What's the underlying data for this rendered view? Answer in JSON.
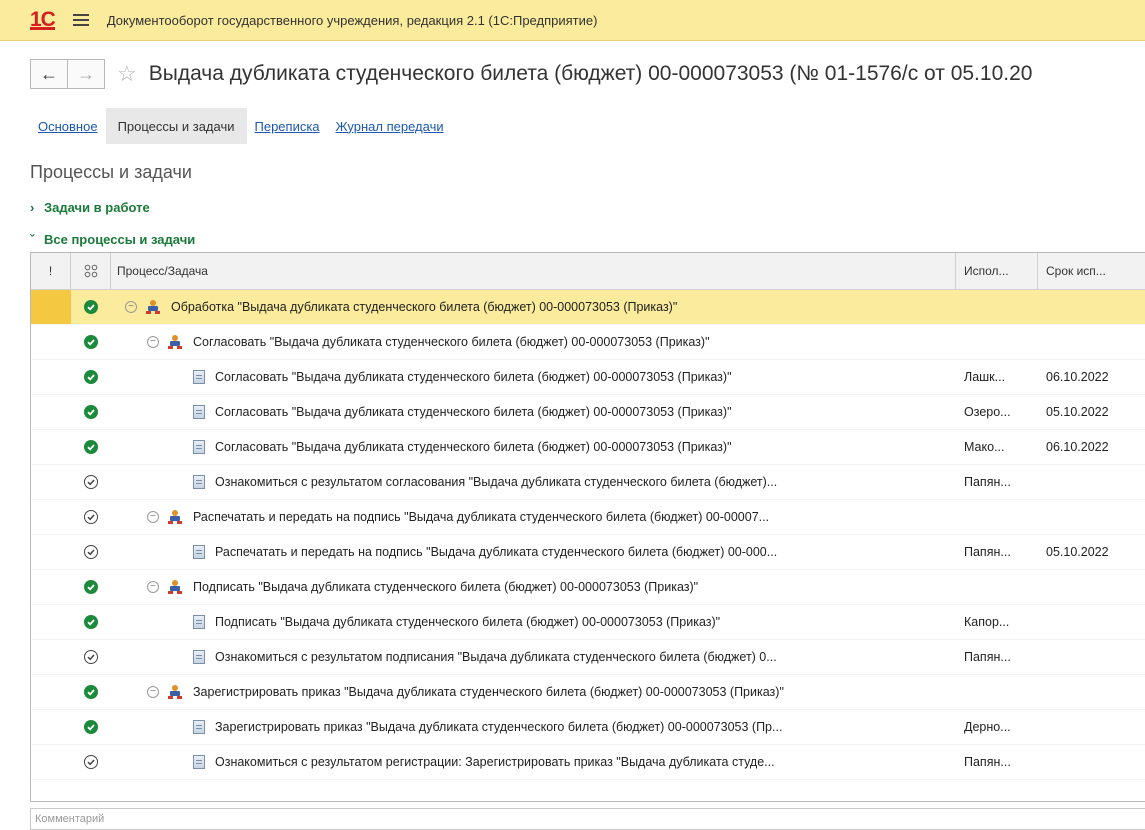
{
  "app": {
    "logo": "1С",
    "title": "Документооборот государственного учреждения, редакция 2.1  (1С:Предприятие)"
  },
  "document": {
    "title": "Выдача дубликата студенческого билета (бюджет) 00-000073053 (№ 01-1576/с от 05.10.20"
  },
  "tabs": [
    {
      "label": "Основное",
      "active": false
    },
    {
      "label": "Процессы и задачи",
      "active": true
    },
    {
      "label": "Переписка",
      "active": false
    },
    {
      "label": "Журнал передачи",
      "active": false
    }
  ],
  "section": {
    "title": "Процессы и задачи"
  },
  "groups": {
    "tasks_in_work": "Задачи в работе",
    "all_processes": "Все процессы и задачи"
  },
  "grid": {
    "headers": {
      "importance": "!",
      "state_icon": "status-icon",
      "process": "Процесс/Задача",
      "performer": "Испол...",
      "deadline": "Срок исп..."
    },
    "rows": [
      {
        "state": "done",
        "type": "process",
        "level": 0,
        "label": "Обработка \"Выдача дубликата студенческого билета (бюджет) 00-000073053 (Приказ)\"",
        "performer": "",
        "deadline": "",
        "selected": true
      },
      {
        "state": "done",
        "type": "process",
        "level": 1,
        "label": "Согласовать \"Выдача дубликата студенческого билета (бюджет) 00-000073053 (Приказ)\"",
        "performer": "",
        "deadline": ""
      },
      {
        "state": "done",
        "type": "task",
        "level": 2,
        "label": "Согласовать \"Выдача дубликата студенческого билета (бюджет) 00-000073053 (Приказ)\"",
        "performer": "Лашк...",
        "deadline": "06.10.2022"
      },
      {
        "state": "done",
        "type": "task",
        "level": 2,
        "label": "Согласовать \"Выдача дубликата студенческого билета (бюджет) 00-000073053 (Приказ)\"",
        "performer": "Озеро...",
        "deadline": "05.10.2022"
      },
      {
        "state": "done",
        "type": "task",
        "level": 2,
        "label": "Согласовать \"Выдача дубликата студенческого билета (бюджет) 00-000073053 (Приказ)\"",
        "performer": "Мако...",
        "deadline": "06.10.2022"
      },
      {
        "state": "open",
        "type": "task",
        "level": 2,
        "label": "Ознакомиться с результатом согласования \"Выдача дубликата студенческого билета (бюджет)...",
        "performer": "Папян...",
        "deadline": ""
      },
      {
        "state": "open",
        "type": "process",
        "level": 1,
        "label": "Распечатать и передать на подпись \"Выдача дубликата студенческого билета (бюджет) 00-00007...",
        "performer": "",
        "deadline": ""
      },
      {
        "state": "open",
        "type": "task",
        "level": 2,
        "label": "Распечатать и передать на подпись \"Выдача дубликата студенческого билета (бюджет) 00-000...",
        "performer": "Папян...",
        "deadline": "05.10.2022"
      },
      {
        "state": "done",
        "type": "process",
        "level": 1,
        "label": "Подписать \"Выдача дубликата студенческого билета (бюджет) 00-000073053 (Приказ)\"",
        "performer": "",
        "deadline": ""
      },
      {
        "state": "done",
        "type": "task",
        "level": 2,
        "label": "Подписать \"Выдача дубликата студенческого билета (бюджет) 00-000073053 (Приказ)\"",
        "performer": "Капор...",
        "deadline": ""
      },
      {
        "state": "open",
        "type": "task",
        "level": 2,
        "label": "Ознакомиться с результатом подписания \"Выдача дубликата студенческого билета (бюджет) 0...",
        "performer": "Папян...",
        "deadline": ""
      },
      {
        "state": "done",
        "type": "process",
        "level": 1,
        "label": "Зарегистрировать приказ \"Выдача дубликата студенческого билета (бюджет) 00-000073053 (Приказ)\"",
        "performer": "",
        "deadline": ""
      },
      {
        "state": "done",
        "type": "task",
        "level": 2,
        "label": "Зарегистрировать приказ \"Выдача дубликата студенческого билета (бюджет) 00-000073053 (Пр...",
        "performer": "Дерно...",
        "deadline": ""
      },
      {
        "state": "open",
        "type": "task",
        "level": 2,
        "label": "Ознакомиться с результатом регистрации: Зарегистрировать приказ \"Выдача дубликата студе...",
        "performer": "Папян...",
        "deadline": ""
      }
    ]
  },
  "comment": {
    "placeholder": "Комментарий"
  },
  "colors": {
    "titlebar": "#fbeb9c",
    "done": "#1b8a3a",
    "group": "#1a7a3a",
    "link": "#1b57b0"
  }
}
